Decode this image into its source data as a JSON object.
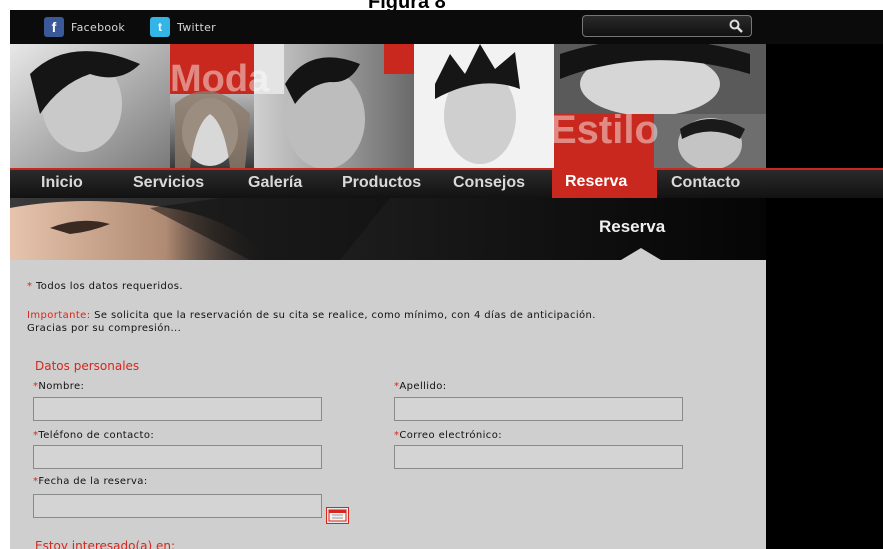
{
  "caption": {
    "text": "Figura 8"
  },
  "topbar": {
    "facebook_label": "Facebook",
    "facebook_glyph": "f",
    "twitter_label": "Twitter",
    "twitter_glyph": "t",
    "search_placeholder": "",
    "colors": {
      "facebook": "#3b5998",
      "twitter": "#33b6e6"
    }
  },
  "banner": {
    "word_left": "Moda",
    "word_right": "Estilo",
    "accent_color": "#c8281e"
  },
  "nav": {
    "items": [
      "Inicio",
      "Servicios",
      "Galería",
      "Productos",
      "Consejos",
      "Reserva",
      "Contacto"
    ],
    "active": "Reserva"
  },
  "header": {
    "title": "Reserva"
  },
  "form": {
    "required_mark": "*",
    "required_note": "Todos los datos requeridos.",
    "important_label": "Importante:",
    "important_text": "Se solicita que la reservación de su cita se realice, como mínimo, con 4 días de anticipación.",
    "thanks_text": "Gracias por su compresión...",
    "section_personal": "Datos personales",
    "labels": {
      "nombre": "Nombre:",
      "apellido": "Apellido:",
      "telefono": "Teléfono de contacto:",
      "correo": "Correo electrónico:",
      "fecha": "Fecha de la reserva:"
    },
    "values": {
      "nombre": "",
      "apellido": "",
      "telefono": "",
      "correo": "",
      "fecha": ""
    },
    "section_interest": "Estoy interesado(a) en:",
    "icons": {
      "calendar": "calendar-icon",
      "search": "search-icon"
    }
  }
}
